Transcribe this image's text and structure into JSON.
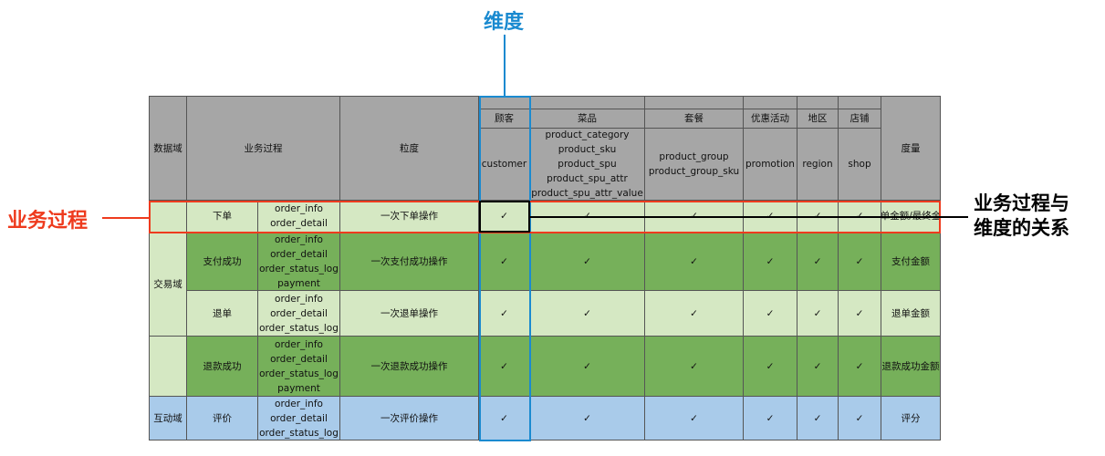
{
  "annotations": {
    "dimension_label": "维度",
    "process_label": "业务过程",
    "relation_label_line1": "业务过程与",
    "relation_label_line2": "维度的关系"
  },
  "header": {
    "domain": "数据域",
    "process": "业务过程",
    "grain": "粒度",
    "measure": "度量",
    "dimensions": [
      {
        "group": "顾客",
        "attrs": [
          "customer"
        ]
      },
      {
        "group": "菜品",
        "attrs": [
          "product_category",
          "product_sku",
          "product_spu",
          "product_spu_attr",
          "product_spu_attr_value"
        ]
      },
      {
        "group": "套餐",
        "attrs": [
          "product_group",
          "product_group_sku"
        ]
      },
      {
        "group": "优惠活动",
        "attrs": [
          "promotion"
        ]
      },
      {
        "group": "地区",
        "attrs": [
          "region"
        ]
      },
      {
        "group": "店铺",
        "attrs": [
          "shop"
        ]
      }
    ]
  },
  "check_mark": "✓",
  "domains": [
    "交易域",
    "互动域"
  ],
  "rows": [
    {
      "process": "下单",
      "tables": [
        "order_info",
        "order_detail"
      ],
      "grain": "一次下单操作",
      "measure": "下单金额/最终金额"
    },
    {
      "process": "支付成功",
      "tables": [
        "order_info",
        "order_detail",
        "order_status_log",
        "payment"
      ],
      "grain": "一次支付成功操作",
      "measure": "支付金额"
    },
    {
      "process": "退单",
      "tables": [
        "order_info",
        "order_detail",
        "order_status_log"
      ],
      "grain": "一次退单操作",
      "measure": "退单金额"
    },
    {
      "process": "退款成功",
      "tables": [
        "order_info",
        "order_detail",
        "order_status_log",
        "payment"
      ],
      "grain": "一次退款成功操作",
      "measure": "退款成功金额"
    },
    {
      "process": "评价",
      "tables": [
        "order_info",
        "order_detail",
        "order_status_log"
      ],
      "grain": "一次评价操作",
      "measure": "评分"
    }
  ],
  "colors": {
    "red": "#ee3b1e",
    "blue": "#1a8ad0",
    "header_gray": "#a6a6a6",
    "light_green": "#d5e8c3",
    "dark_green": "#76b05a",
    "light_blue": "#a9cbea"
  }
}
